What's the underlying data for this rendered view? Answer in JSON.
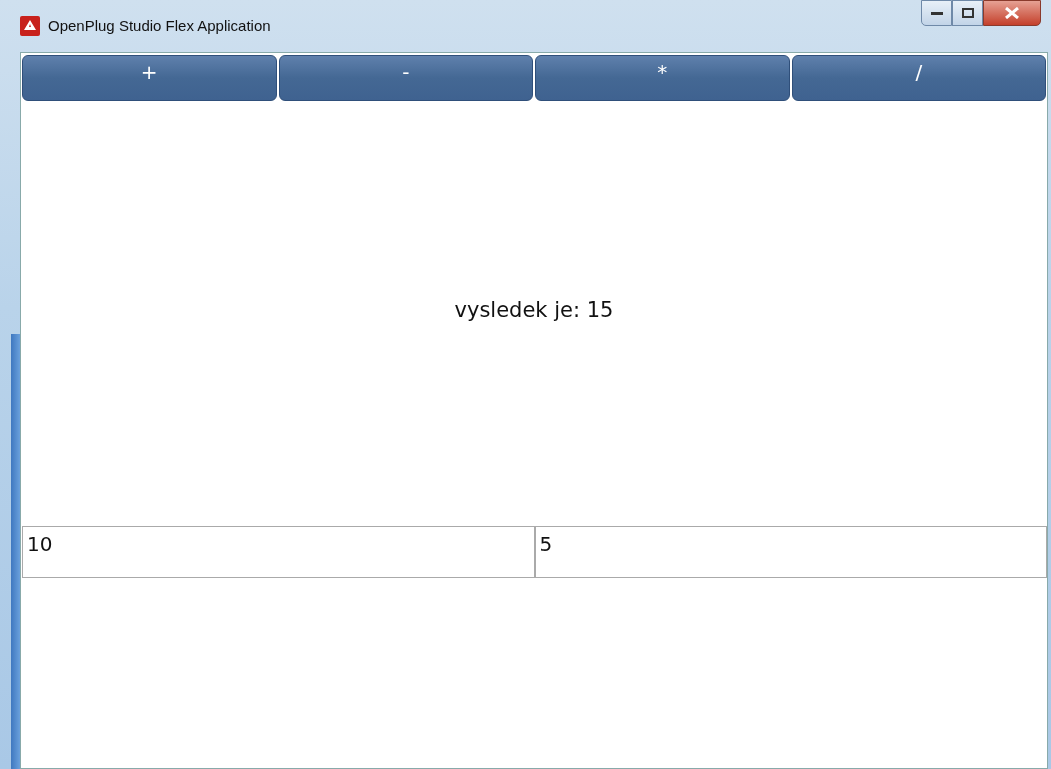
{
  "window": {
    "title": "OpenPlug Studio Flex Application"
  },
  "operations": [
    {
      "label": "+"
    },
    {
      "label": "-"
    },
    {
      "label": "*"
    },
    {
      "label": "/"
    }
  ],
  "result": "vysledek je: 15",
  "inputs": [
    {
      "value": "10"
    },
    {
      "value": "5"
    }
  ]
}
